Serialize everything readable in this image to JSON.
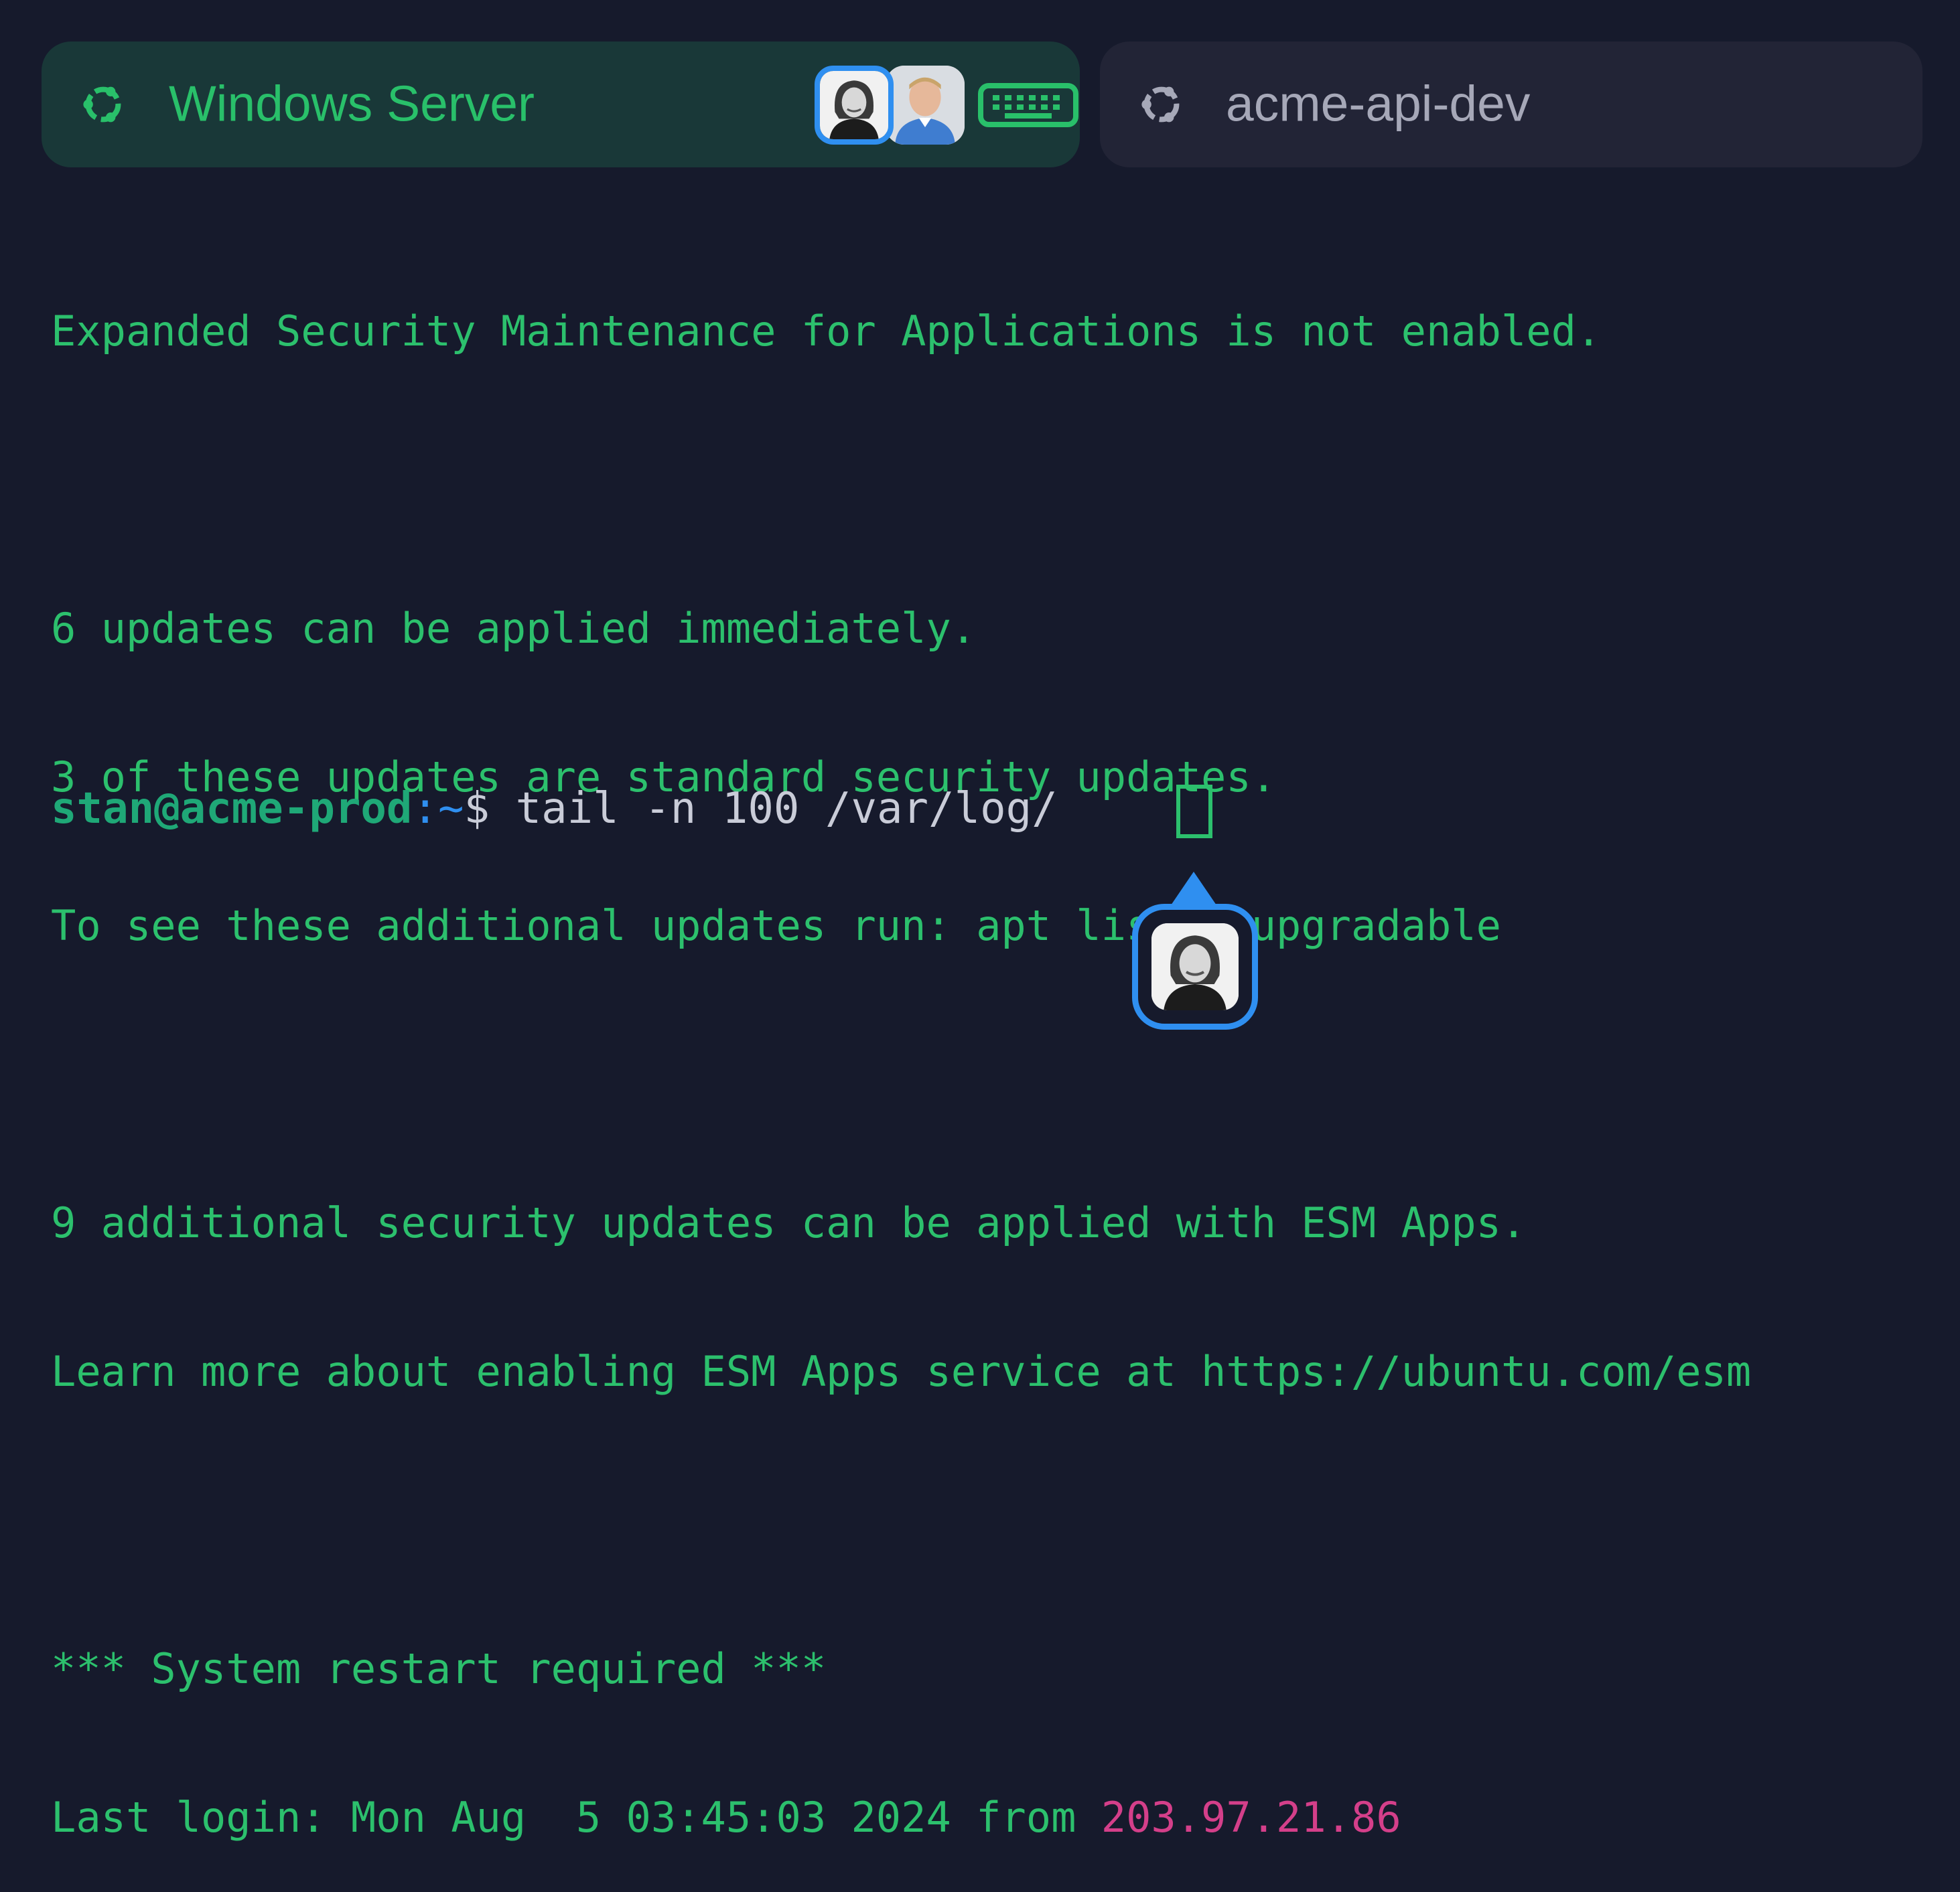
{
  "tabs": [
    {
      "title": "Windows Server",
      "active": true,
      "icon": "ubuntu-icon",
      "collaborators": [
        "user-woman-avatar",
        "user-man-avatar"
      ],
      "action_icon": "keyboard-icon"
    },
    {
      "title": "acme-api-dev",
      "active": false,
      "icon": "ubuntu-icon"
    }
  ],
  "terminal": {
    "lines": [
      "Expanded Security Maintenance for Applications is not enabled.",
      "",
      "6 updates can be applied immediately.",
      "3 of these updates are standard security updates.",
      "To see these additional updates run: apt list --upgradable",
      "",
      "9 additional security updates can be applied with ESM Apps.",
      "Learn more about enabling ESM Apps service at https://ubuntu.com/esm",
      "",
      "*** System restart required ***"
    ],
    "last_login_prefix": "Last login: Mon Aug  5 03:45:03 2024 from ",
    "last_login_ip": "203.97.21.86",
    "prompt_user_host": "stan@acme-prod",
    "prompt_colon": ":",
    "prompt_path": "~",
    "prompt_symbol": "$ ",
    "command": "tail -n 100 /var/log/ "
  },
  "colors": {
    "background": "#161a2c",
    "terminal_text": "#2cc06d",
    "ip_highlight": "#d43f8a",
    "collaborator_accent": "#2f8ff0",
    "active_tab": "#193838",
    "inactive_tab": "#222436"
  },
  "collab_cursor": {
    "user": "user-woman-avatar"
  }
}
